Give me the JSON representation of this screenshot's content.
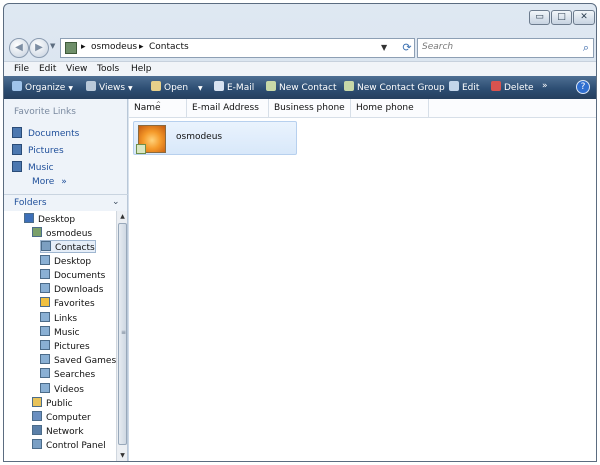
{
  "window": {
    "controls": {
      "minimize": "▭",
      "maximize": "□",
      "close": "✕"
    }
  },
  "nav": {
    "back_glyph": "◀",
    "forward_glyph": "▶",
    "breadcrumb": [
      "osmodeus",
      "Contacts"
    ],
    "crumb_separator": "▸",
    "search_placeholder": "Search",
    "refresh_glyph": "⟳",
    "dropdown_glyph": "▼"
  },
  "menu": [
    "File",
    "Edit",
    "View",
    "Tools",
    "Help"
  ],
  "toolbar": {
    "items": [
      {
        "label": "Organize",
        "icon": "organize-icon",
        "dropdown": true,
        "color": "#9fc3ea"
      },
      {
        "label": "Views",
        "icon": "views-icon",
        "dropdown": true,
        "color": "#b9c9d9"
      },
      {
        "label": "Open",
        "icon": "open-icon",
        "dropdown": true,
        "color": "#e7d08a"
      },
      {
        "label": "E-Mail",
        "icon": "email-icon",
        "dropdown": false,
        "color": "#d9e4f2"
      },
      {
        "label": "New Contact",
        "icon": "new-contact-icon",
        "dropdown": false,
        "color": "#c8d9a8"
      },
      {
        "label": "New Contact Group",
        "icon": "new-contact-group-icon",
        "dropdown": false,
        "color": "#c8d9a8"
      },
      {
        "label": "Edit",
        "icon": "edit-icon",
        "dropdown": false,
        "color": "#c2d5ea"
      },
      {
        "label": "Delete",
        "icon": "delete-icon",
        "dropdown": false,
        "color": "#d9534f"
      }
    ],
    "overflow": "»",
    "help": "?"
  },
  "left_pane": {
    "favorites_title": "Favorite Links",
    "favorites": [
      "Documents",
      "Pictures",
      "Music"
    ],
    "more_label": "More",
    "more_chevron": "»",
    "folders_label": "Folders",
    "folders_chevron": "⌄",
    "tree": [
      {
        "label": "Desktop",
        "level": 0,
        "icon": "desktop-icon"
      },
      {
        "label": "osmodeus",
        "level": 1,
        "icon": "user-folder-icon"
      },
      {
        "label": "Contacts",
        "level": 2,
        "icon": "contacts-icon",
        "selected": true
      },
      {
        "label": "Desktop",
        "level": 2,
        "icon": "desktop-folder-icon"
      },
      {
        "label": "Documents",
        "level": 2,
        "icon": "documents-icon"
      },
      {
        "label": "Downloads",
        "level": 2,
        "icon": "downloads-icon"
      },
      {
        "label": "Favorites",
        "level": 2,
        "icon": "favorites-icon"
      },
      {
        "label": "Links",
        "level": 2,
        "icon": "links-icon"
      },
      {
        "label": "Music",
        "level": 2,
        "icon": "music-icon"
      },
      {
        "label": "Pictures",
        "level": 2,
        "icon": "pictures-icon"
      },
      {
        "label": "Saved Games",
        "level": 2,
        "icon": "saved-games-icon"
      },
      {
        "label": "Searches",
        "level": 2,
        "icon": "searches-icon"
      },
      {
        "label": "Videos",
        "level": 2,
        "icon": "videos-icon"
      },
      {
        "label": "Public",
        "level": 1,
        "icon": "public-folder-icon"
      },
      {
        "label": "Computer",
        "level": 1,
        "icon": "computer-icon"
      },
      {
        "label": "Network",
        "level": 1,
        "icon": "network-icon"
      },
      {
        "label": "Control Panel",
        "level": 1,
        "icon": "control-panel-icon"
      }
    ]
  },
  "columns": [
    "Name",
    "E-mail Address",
    "Business phone",
    "Home phone"
  ],
  "sort_glyph": "^",
  "contacts": [
    {
      "name": "osmodeus"
    }
  ]
}
